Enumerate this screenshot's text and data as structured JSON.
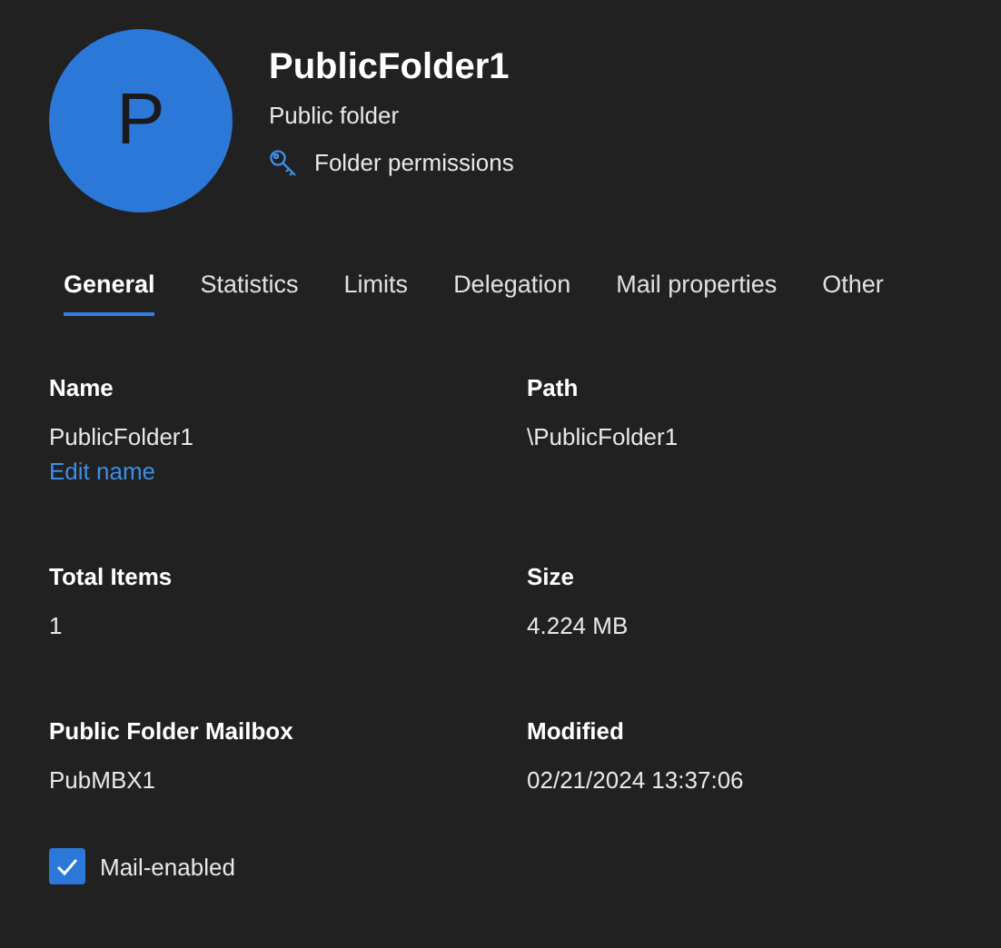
{
  "header": {
    "avatar_initial": "P",
    "title": "PublicFolder1",
    "subtitle": "Public folder",
    "link": "Folder permissions"
  },
  "tabs": [
    {
      "label": "General",
      "selected": true
    },
    {
      "label": "Statistics",
      "selected": false
    },
    {
      "label": "Limits",
      "selected": false
    },
    {
      "label": "Delegation",
      "selected": false
    },
    {
      "label": "Mail properties",
      "selected": false
    },
    {
      "label": "Other",
      "selected": false
    }
  ],
  "fields": [
    {
      "label": "Name",
      "value": "PublicFolder1",
      "link": "Edit name"
    },
    {
      "label": "Path",
      "value": "\\PublicFolder1"
    },
    {
      "label": "Total Items",
      "value": "1"
    },
    {
      "label": "Size",
      "value": "4.224 MB"
    },
    {
      "label": "Public Folder Mailbox",
      "value": "PubMBX1"
    },
    {
      "label": "Modified",
      "value": "02/21/2024 13:37:06"
    }
  ],
  "checkbox": {
    "label": "Mail-enabled",
    "checked": true
  }
}
